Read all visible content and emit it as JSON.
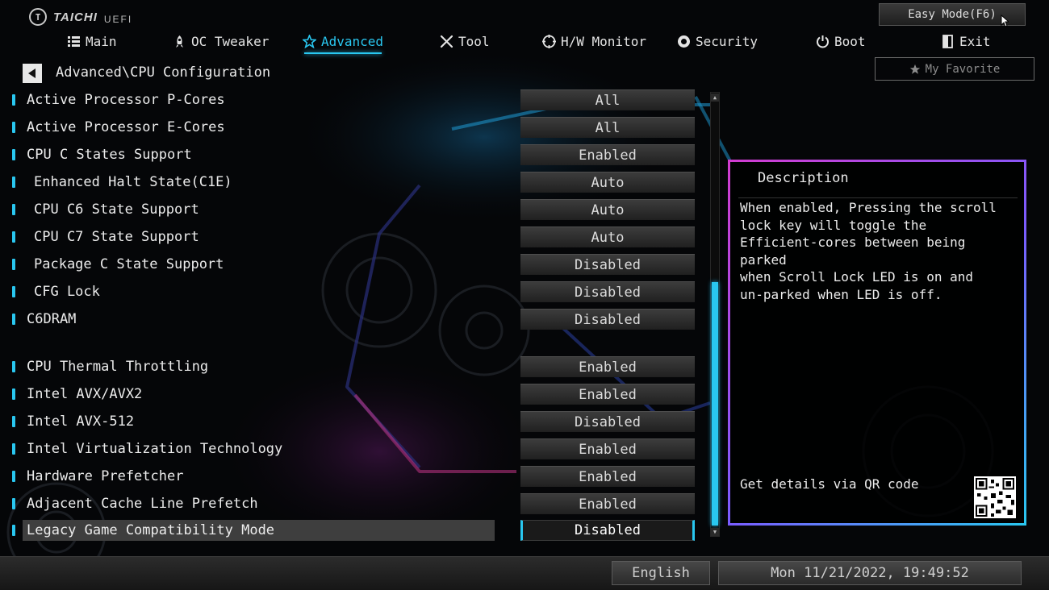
{
  "brand": {
    "name": "TAICHI",
    "sub": "UEFI"
  },
  "easy_mode_label": "Easy Mode(F6)",
  "tabs": [
    {
      "label": "Main",
      "icon": "list-icon"
    },
    {
      "label": "OC Tweaker",
      "icon": "rocket-icon"
    },
    {
      "label": "Advanced",
      "icon": "star-icon",
      "active": true
    },
    {
      "label": "Tool",
      "icon": "tools-icon"
    },
    {
      "label": "H/W Monitor",
      "icon": "monitor-icon"
    },
    {
      "label": "Security",
      "icon": "shield-icon"
    },
    {
      "label": "Boot",
      "icon": "power-icon"
    },
    {
      "label": "Exit",
      "icon": "exit-door-icon"
    }
  ],
  "favorite_label": "My Favorite",
  "breadcrumb": "Advanced\\CPU Configuration",
  "settings": [
    {
      "label": "Active Processor P-Cores",
      "value": "All"
    },
    {
      "label": "Active Processor E-Cores",
      "value": "All"
    },
    {
      "label": "CPU C States Support",
      "value": "Enabled"
    },
    {
      "label": "Enhanced Halt State(C1E)",
      "value": "Auto"
    },
    {
      "label": "CPU C6 State Support",
      "value": "Auto"
    },
    {
      "label": "CPU C7 State Support",
      "value": "Auto"
    },
    {
      "label": "Package C State Support",
      "value": "Disabled"
    },
    {
      "label": "CFG Lock",
      "value": "Disabled"
    },
    {
      "label": "C6DRAM",
      "value": "Disabled"
    },
    {
      "label": "CPU Thermal Throttling",
      "value": "Enabled"
    },
    {
      "label": "Intel AVX/AVX2",
      "value": "Enabled"
    },
    {
      "label": "Intel AVX-512",
      "value": "Disabled"
    },
    {
      "label": "Intel Virtualization Technology",
      "value": "Enabled"
    },
    {
      "label": "Hardware Prefetcher",
      "value": "Enabled"
    },
    {
      "label": "Adjacent Cache Line Prefetch",
      "value": "Enabled"
    },
    {
      "label": "Legacy Game Compatibility Mode",
      "value": "Disabled",
      "selected": true
    }
  ],
  "description": {
    "title": "Description",
    "text": "When enabled, Pressing the scroll\nlock key will toggle the\nEfficient-cores between being parked\nwhen Scroll Lock LED is on and\nun-parked when LED is off.",
    "qr_label": "Get details via QR code"
  },
  "footer": {
    "language": "English",
    "datetime": "Mon 11/21/2022, 19:49:52"
  },
  "colors": {
    "accent": "#29c7f0",
    "panel_border": "#d23cd0"
  }
}
